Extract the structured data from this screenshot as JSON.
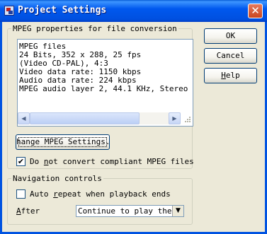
{
  "window": {
    "title": "Project Settings",
    "close_glyph": "✕"
  },
  "mpeg_group": {
    "legend": "MPEG properties for file conversion",
    "lines": [
      "MPEG files",
      "24 Bits, 352 x 288, 25 fps",
      "(Video CD-PAL),  4:3",
      "Video data rate: 1150 kbps",
      "Audio data rate: 224 kbps",
      "MPEG audio layer 2, 44.1 KHz, Stereo"
    ],
    "scroll_left_glyph": "◀",
    "scroll_right_glyph": "▶",
    "change_button_label": "hange MPEG Settings...",
    "no_convert_checkbox": {
      "checked": true,
      "check_glyph": "✔",
      "label_pre": "Do ",
      "label_underlined": "n",
      "label_post": "ot convert compliant MPEG files"
    }
  },
  "nav_group": {
    "legend": "Navigation controls",
    "auto_repeat_checkbox": {
      "checked": false,
      "label_pre": "Auto ",
      "label_underlined": "r",
      "label_post": "epeat when playback ends"
    },
    "after_label_underlined": "A",
    "after_label_rest": "fter",
    "after_select_value": "Continue to play the n",
    "dropdown_glyph": "▼"
  },
  "buttons": {
    "ok": "OK",
    "cancel": "Cancel",
    "help_underlined": "H",
    "help_rest": "elp"
  }
}
